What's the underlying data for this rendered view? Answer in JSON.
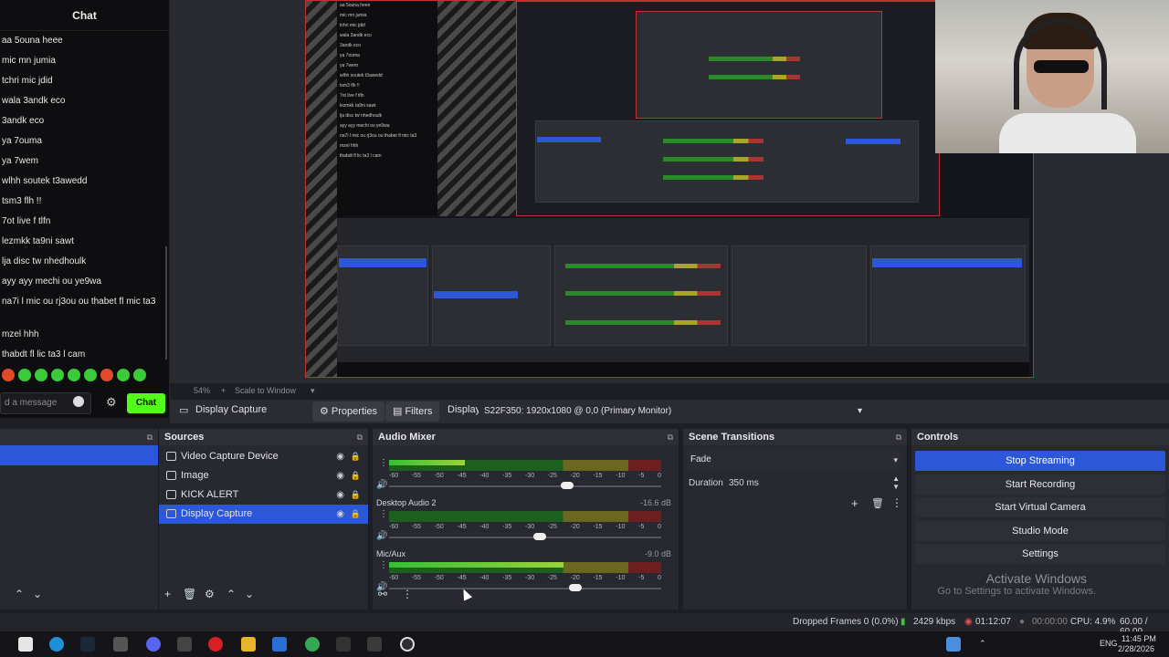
{
  "chat": {
    "title": "Chat",
    "messages": [
      "aa 5ouna heee",
      "mic mn jumia",
      "tchri mic jdid",
      "wala 3andk eco",
      "3andk eco",
      "ya 7ouma",
      "ya 7wem",
      "wlhh soutek t3awedd",
      "tsm3 flh !!",
      "7ot live f tlfn",
      "lezmkk ta9ni sawt",
      "lja disc tw nhedhoulk",
      "ayy ayy mechi ou ye9wa",
      "na7i l mic ou rj3ou ou thabet fl mic ta3",
      "mzel hhh",
      "thabdt fl lic ta3 l cam"
    ],
    "input_placeholder": "d a message",
    "send_label": "Chat"
  },
  "preview": {
    "zoom": "54%",
    "scale_label": "Scale to Window"
  },
  "source_toolbar": {
    "source_name": "Display Capture",
    "properties_label": "Properties",
    "filters_label": "Filters",
    "display_label": "Display",
    "display_value": "S22F350: 1920x1080 @ 0,0 (Primary Monitor)"
  },
  "sources": {
    "title": "Sources",
    "items": [
      {
        "label": "Video Capture Device",
        "selected": false
      },
      {
        "label": "Image",
        "selected": false
      },
      {
        "label": "KICK ALERT",
        "selected": false
      },
      {
        "label": "Display Capture",
        "selected": true
      }
    ]
  },
  "mixer": {
    "title": "Audio Mixer",
    "ticks": [
      "-60",
      "-55",
      "-50",
      "-45",
      "-40",
      "-35",
      "-30",
      "-25",
      "-20",
      "-15",
      "-10",
      "-5",
      "0"
    ],
    "channels": [
      {
        "name": "",
        "db": "",
        "level": 0.28,
        "fader": 0.63
      },
      {
        "name": "Desktop Audio 2",
        "db": "-16.6 dB",
        "level": 0.0,
        "fader": 0.53
      },
      {
        "name": "Mic/Aux",
        "db": "-9.0 dB",
        "level": 0.64,
        "fader": 0.66
      }
    ]
  },
  "transitions": {
    "title": "Scene Transitions",
    "selected": "Fade",
    "duration_label": "Duration",
    "duration_value": "350 ms"
  },
  "controls": {
    "title": "Controls",
    "buttons": [
      "Stop Streaming",
      "Start Recording",
      "Start Virtual Camera",
      "Studio Mode",
      "Settings"
    ]
  },
  "watermark": {
    "line1": "Activate Windows",
    "line2": "Go to Settings to activate Windows."
  },
  "status": {
    "dropped": "Dropped Frames 0 (0.0%)",
    "bitrate": "2429 kbps",
    "stream_time": "01:12:07",
    "rec_time": "00:00:00",
    "cpu": "CPU: 4.9%",
    "fps": "60.00 / 60.00"
  },
  "taskbar": {
    "lang": "ENG",
    "time": "11:45 PM",
    "date": "2/28/2026"
  }
}
